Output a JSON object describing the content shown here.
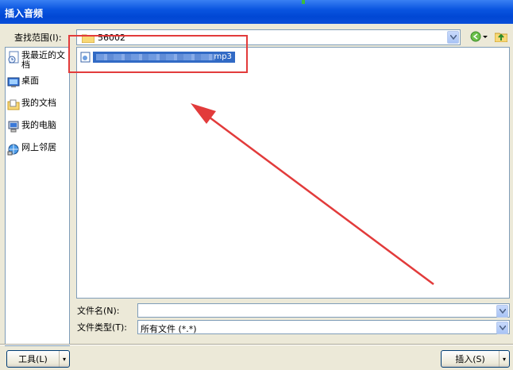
{
  "window": {
    "title": "插入音频"
  },
  "lookin": {
    "label": "查找范围(I):",
    "value": "56002"
  },
  "places": [
    {
      "label": "我最近的文档",
      "icon": "recent-docs-icon"
    },
    {
      "label": "桌面",
      "icon": "desktop-icon"
    },
    {
      "label": "我的文档",
      "icon": "my-documents-icon"
    },
    {
      "label": "我的电脑",
      "icon": "my-computer-icon"
    },
    {
      "label": "网上邻居",
      "icon": "network-places-icon"
    }
  ],
  "files": [
    {
      "name_suffix": "mp3",
      "selected": true
    }
  ],
  "filename": {
    "label": "文件名(N):",
    "value": ""
  },
  "filetype": {
    "label": "文件类型(T):",
    "value": "所有文件 (*.*)"
  },
  "buttons": {
    "tools": "工具(L)",
    "insert": "插入(S)"
  },
  "annotations": {
    "box_color": "#e23b3b",
    "arrow_color": "#e23b3b"
  }
}
